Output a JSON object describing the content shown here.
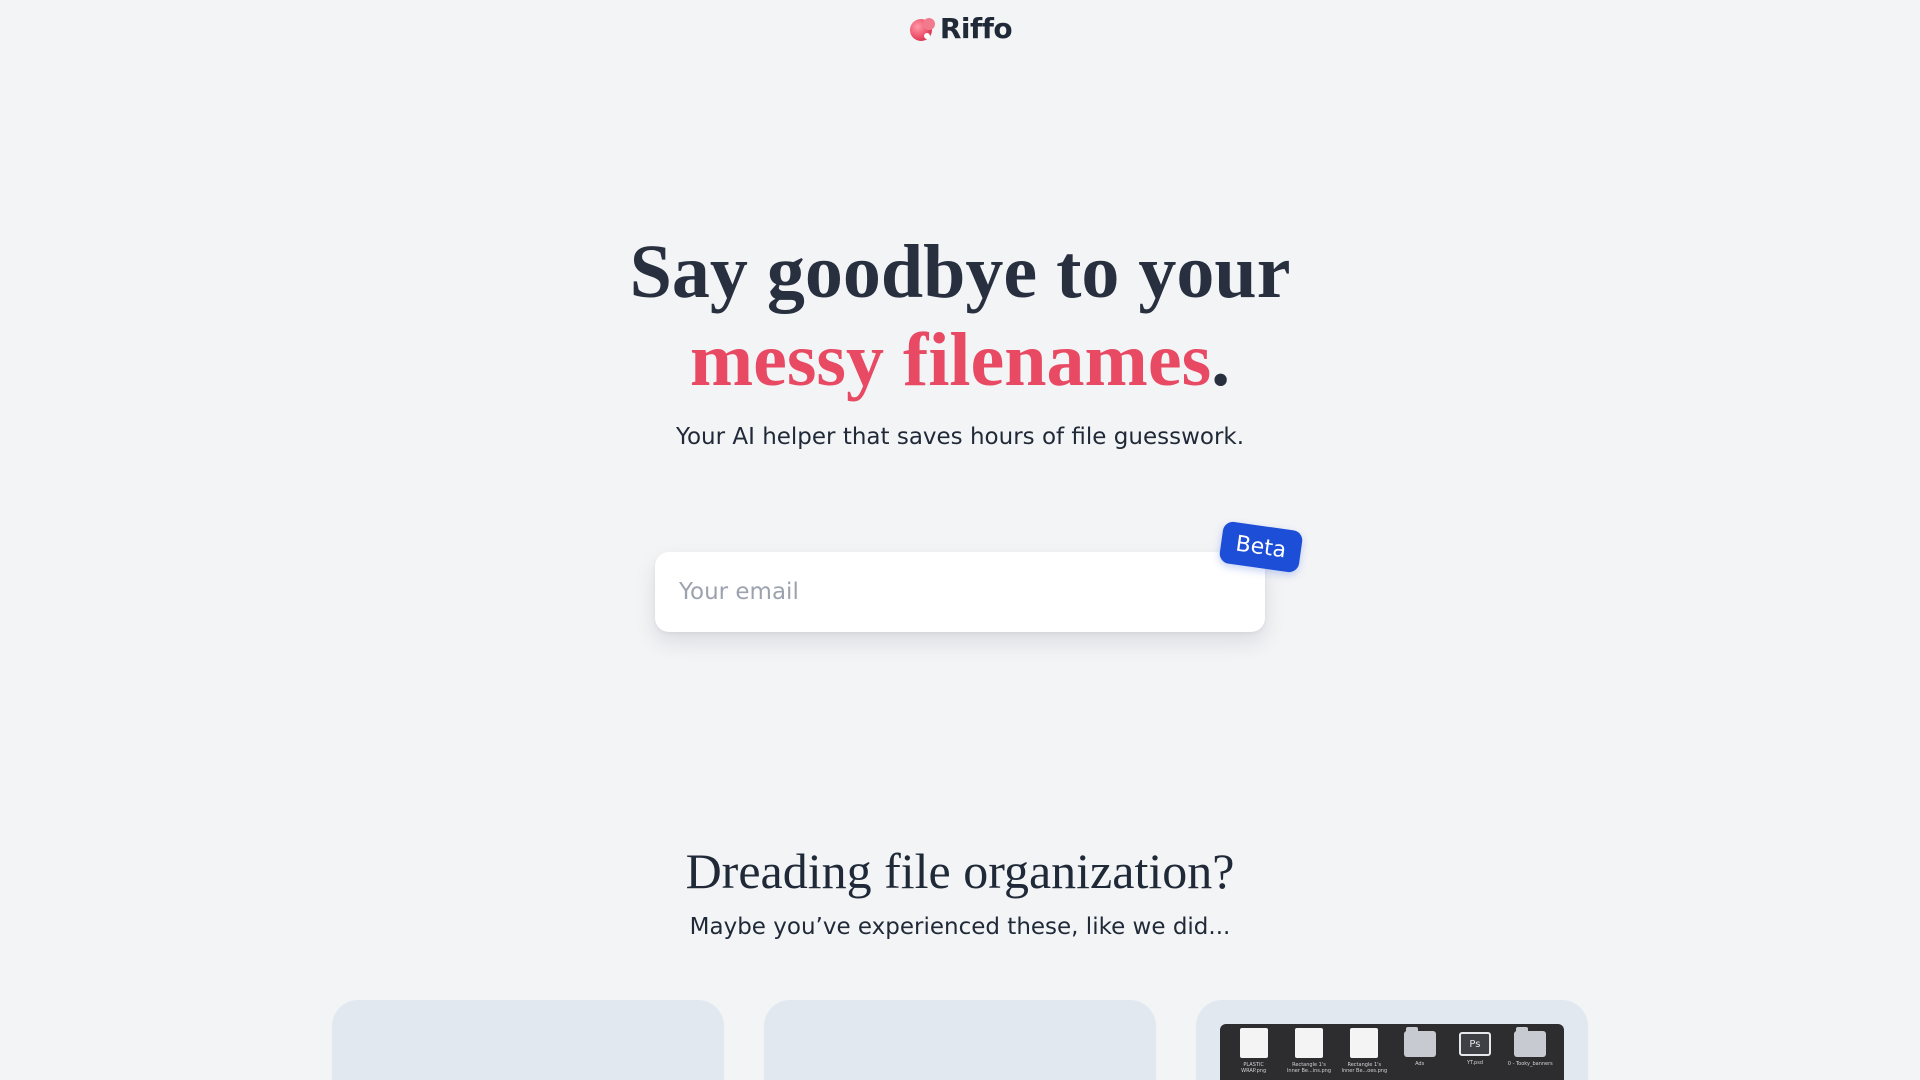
{
  "brand": {
    "name": "Riffo",
    "accent_color": "#e84a63",
    "logo_icon": "blob-icon"
  },
  "hero": {
    "title_line1": "Say goodbye to your",
    "title_accent": "messy filenames",
    "title_period": ".",
    "subtitle": "Your AI helper that saves hours of file guesswork."
  },
  "signup": {
    "email_placeholder": "Your email",
    "email_value": "",
    "badge": "Beta",
    "badge_color": "#1d4ed8"
  },
  "problems": {
    "title": "Dreading file organization?",
    "subtitle": "Maybe you’ve experienced these, like we did..."
  },
  "cards": {
    "card3": {
      "files": [
        {
          "icon": "document-icon",
          "name": "PLASTIC WRAP.png"
        },
        {
          "icon": "document-icon",
          "name": "Rectangle 1's Inner Be...ins.png"
        },
        {
          "icon": "document-icon",
          "name": "Rectangle 1's Inner Be...oes.png"
        },
        {
          "icon": "folder-icon",
          "name": "Ads"
        },
        {
          "icon": "monitor-icon",
          "name": "YT.psd"
        },
        {
          "icon": "folder-icon",
          "name": "0 - Tooky_banners"
        }
      ]
    }
  }
}
